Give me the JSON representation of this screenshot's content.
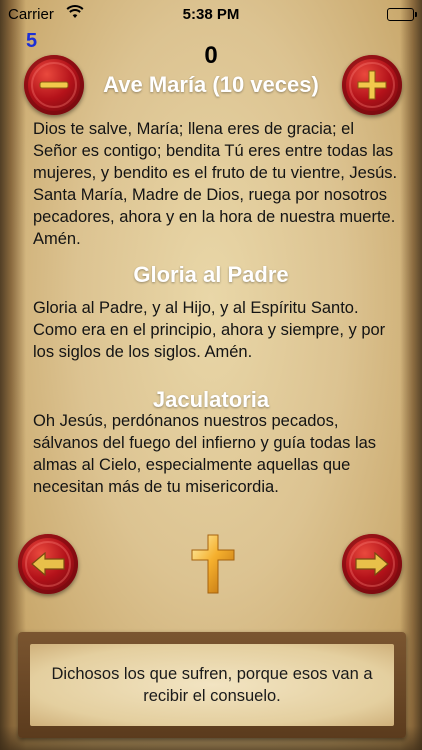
{
  "status_bar": {
    "carrier": "Carrier",
    "time": "5:38 PM",
    "battery_level": 1.0
  },
  "counter": {
    "small_value": "5",
    "main_value": "0"
  },
  "prayers": [
    {
      "title": "Ave María (10 veces)",
      "text": "Dios te salve, María; llena eres de gracia; el Señor es contigo; bendita Tú eres entre todas las mujeres, y bendito es el fruto de tu vientre, Jesús. Santa María, Madre de Dios, ruega por nosotros pecadores, ahora y en la hora de nuestra muerte. Amén."
    },
    {
      "title": "Gloria al Padre",
      "text": "Gloria al Padre, y al Hijo, y al Espíritu Santo. Como era en el principio, ahora y siempre, y por los siglos de los siglos. Amén."
    },
    {
      "title": "Jaculatoria",
      "text": "Oh Jesús, perdónanos nuestros pecados, sálvanos del fuego del infierno y guía todas las almas al Cielo, especialmente aquellas que necesitan más de tu misericordia."
    }
  ],
  "quote": "Dichosos los que sufren, porque esos van a recibir el consuelo.",
  "icons": {
    "decrement": "minus-icon",
    "increment": "plus-icon",
    "previous": "arrow-left-icon",
    "next": "arrow-right-icon",
    "cross": "cross-icon",
    "wifi": "wifi-icon",
    "battery": "battery-icon"
  },
  "colors": {
    "seal": "#b4121a",
    "seal_glyph": "#f2c94c",
    "heading": "#ffffff",
    "counter_small": "#1b2fd6",
    "cross_gold": "#f5b02e"
  }
}
